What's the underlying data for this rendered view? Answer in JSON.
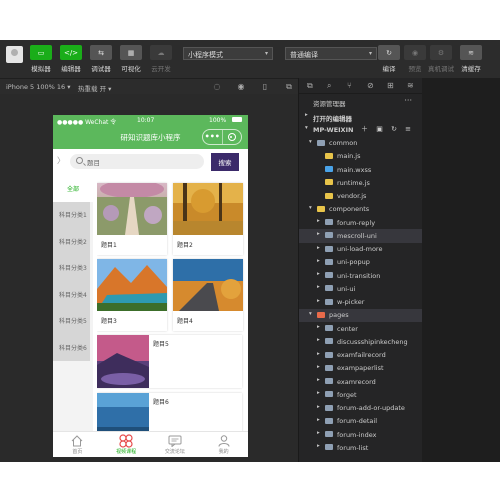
{
  "toolbar": {
    "buttons": [
      {
        "label": "模拟器",
        "icon": "phone-icon",
        "glyph": "▭"
      },
      {
        "label": "编辑器",
        "icon": "code-icon",
        "glyph": "</>"
      },
      {
        "label": "调试器",
        "icon": "debug-icon",
        "glyph": "⇆"
      },
      {
        "label": "可视化",
        "icon": "layout-icon",
        "glyph": "▦"
      },
      {
        "label": "云开发",
        "icon": "cloud-icon",
        "glyph": "☁"
      }
    ],
    "mode_select": "小程序模式",
    "compile_select": "普通编译",
    "right_buttons": [
      {
        "label": "编译",
        "icon": "refresh-icon",
        "glyph": "↻"
      },
      {
        "label": "预览",
        "icon": "eye-icon",
        "glyph": "◉"
      },
      {
        "label": "真机调试",
        "icon": "device-icon",
        "glyph": "⚙"
      },
      {
        "label": "清缓存",
        "icon": "layers-icon",
        "glyph": "≋"
      }
    ]
  },
  "subbar": {
    "device": "iPhone 5 100% 16 ▾",
    "hot_reload": "热重载 开 ▾"
  },
  "phone": {
    "status_left": "●●●●● WeChat 令",
    "status_time": "10:07",
    "status_battery": "100%",
    "nav_title": "研知识题库小程序",
    "search_placeholder": "题目",
    "search_button": "搜索",
    "categories": [
      "全部",
      "科目分类1",
      "科目分类2",
      "科目分类3",
      "科目分类4",
      "科目分类5",
      "科目分类6"
    ],
    "grid_items": [
      "题目1",
      "题目2",
      "题目3",
      "题目4"
    ],
    "list_items": [
      "题目5",
      "题目6"
    ],
    "tabs": [
      {
        "label": "首页",
        "icon": "home-icon"
      },
      {
        "label": "视频课程",
        "icon": "video-course-icon"
      },
      {
        "label": "交流论坛",
        "icon": "chat-icon"
      },
      {
        "label": "我的",
        "icon": "user-icon"
      }
    ]
  },
  "explorer": {
    "title": "资源管理器",
    "open_editors": "打开的编辑器",
    "project": "MP-WEIXIN",
    "tree": [
      {
        "label": "common",
        "type": "folder-open",
        "depth": 1
      },
      {
        "label": "main.js",
        "type": "js",
        "depth": 2
      },
      {
        "label": "main.wxss",
        "type": "css",
        "depth": 2
      },
      {
        "label": "runtime.js",
        "type": "js",
        "depth": 2
      },
      {
        "label": "vendor.js",
        "type": "js",
        "depth": 2
      },
      {
        "label": "components",
        "type": "folder-open-yellow",
        "depth": 1
      },
      {
        "label": "forum-reply",
        "type": "folder",
        "depth": 2
      },
      {
        "label": "mescroll-uni",
        "type": "folder",
        "depth": 2,
        "selected": true
      },
      {
        "label": "uni-load-more",
        "type": "folder",
        "depth": 2
      },
      {
        "label": "uni-popup",
        "type": "folder",
        "depth": 2
      },
      {
        "label": "uni-transition",
        "type": "folder",
        "depth": 2
      },
      {
        "label": "uni-ui",
        "type": "folder",
        "depth": 2
      },
      {
        "label": "w-picker",
        "type": "folder",
        "depth": 2
      },
      {
        "label": "pages",
        "type": "folder-open-red",
        "depth": 1,
        "selected": true
      },
      {
        "label": "center",
        "type": "folder",
        "depth": 2
      },
      {
        "label": "discussshipinkecheng",
        "type": "folder",
        "depth": 2
      },
      {
        "label": "examfailrecord",
        "type": "folder",
        "depth": 2
      },
      {
        "label": "exampaperlist",
        "type": "folder",
        "depth": 2
      },
      {
        "label": "examrecord",
        "type": "folder",
        "depth": 2
      },
      {
        "label": "forget",
        "type": "folder",
        "depth": 2
      },
      {
        "label": "forum-add-or-update",
        "type": "folder",
        "depth": 2
      },
      {
        "label": "forum-detail",
        "type": "folder",
        "depth": 2
      },
      {
        "label": "forum-index",
        "type": "folder",
        "depth": 2
      },
      {
        "label": "forum-list",
        "type": "folder",
        "depth": 2
      }
    ]
  },
  "colors": {
    "wechat_green": "#5cb85c",
    "accent_green": "#1aad19",
    "search_button": "#3b2a6a"
  }
}
